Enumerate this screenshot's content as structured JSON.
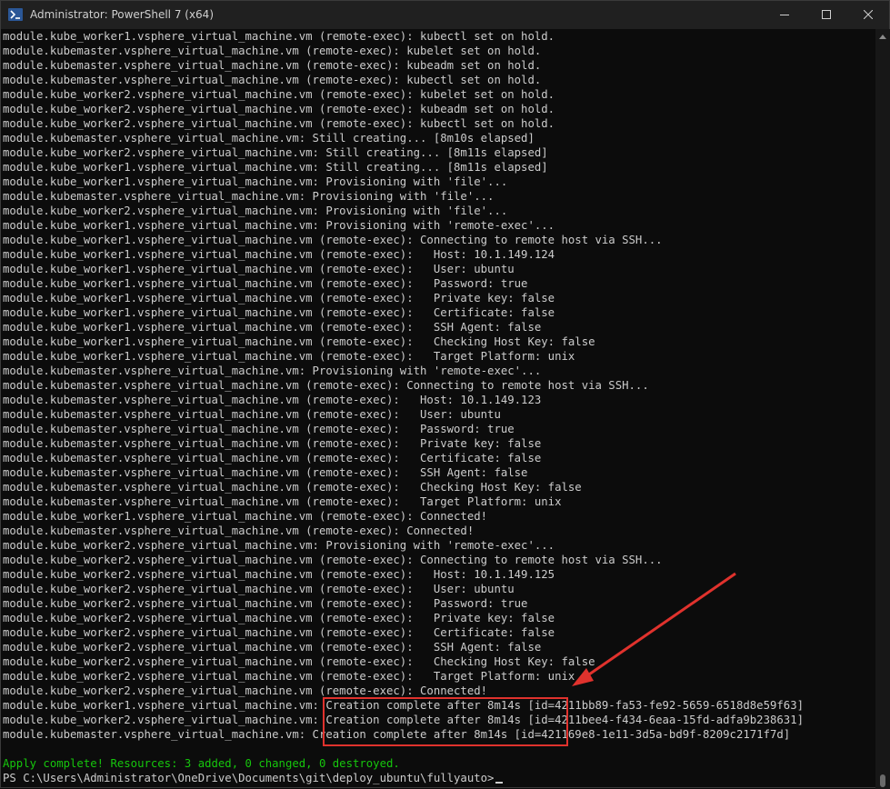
{
  "window": {
    "title": "Administrator: PowerShell 7 (x64)",
    "icon": "powershell-icon",
    "controls": {
      "minimize": "minimize-icon",
      "maximize": "maximize-icon",
      "close": "close-icon"
    }
  },
  "colors": {
    "output": "#cccccc",
    "success": "#16c60c",
    "annotation": "#e0322d"
  },
  "console": {
    "lines": [
      "module.kube_worker1.vsphere_virtual_machine.vm (remote-exec): kubectl set on hold.",
      "module.kubemaster.vsphere_virtual_machine.vm (remote-exec): kubelet set on hold.",
      "module.kubemaster.vsphere_virtual_machine.vm (remote-exec): kubeadm set on hold.",
      "module.kubemaster.vsphere_virtual_machine.vm (remote-exec): kubectl set on hold.",
      "module.kube_worker2.vsphere_virtual_machine.vm (remote-exec): kubelet set on hold.",
      "module.kube_worker2.vsphere_virtual_machine.vm (remote-exec): kubeadm set on hold.",
      "module.kube_worker2.vsphere_virtual_machine.vm (remote-exec): kubectl set on hold.",
      "module.kubemaster.vsphere_virtual_machine.vm: Still creating... [8m10s elapsed]",
      "module.kube_worker2.vsphere_virtual_machine.vm: Still creating... [8m11s elapsed]",
      "module.kube_worker1.vsphere_virtual_machine.vm: Still creating... [8m11s elapsed]",
      "module.kube_worker1.vsphere_virtual_machine.vm: Provisioning with 'file'...",
      "module.kubemaster.vsphere_virtual_machine.vm: Provisioning with 'file'...",
      "module.kube_worker2.vsphere_virtual_machine.vm: Provisioning with 'file'...",
      "module.kube_worker1.vsphere_virtual_machine.vm: Provisioning with 'remote-exec'...",
      "module.kube_worker1.vsphere_virtual_machine.vm (remote-exec): Connecting to remote host via SSH...",
      "module.kube_worker1.vsphere_virtual_machine.vm (remote-exec):   Host: 10.1.149.124",
      "module.kube_worker1.vsphere_virtual_machine.vm (remote-exec):   User: ubuntu",
      "module.kube_worker1.vsphere_virtual_machine.vm (remote-exec):   Password: true",
      "module.kube_worker1.vsphere_virtual_machine.vm (remote-exec):   Private key: false",
      "module.kube_worker1.vsphere_virtual_machine.vm (remote-exec):   Certificate: false",
      "module.kube_worker1.vsphere_virtual_machine.vm (remote-exec):   SSH Agent: false",
      "module.kube_worker1.vsphere_virtual_machine.vm (remote-exec):   Checking Host Key: false",
      "module.kube_worker1.vsphere_virtual_machine.vm (remote-exec):   Target Platform: unix",
      "module.kubemaster.vsphere_virtual_machine.vm: Provisioning with 'remote-exec'...",
      "module.kubemaster.vsphere_virtual_machine.vm (remote-exec): Connecting to remote host via SSH...",
      "module.kubemaster.vsphere_virtual_machine.vm (remote-exec):   Host: 10.1.149.123",
      "module.kubemaster.vsphere_virtual_machine.vm (remote-exec):   User: ubuntu",
      "module.kubemaster.vsphere_virtual_machine.vm (remote-exec):   Password: true",
      "module.kubemaster.vsphere_virtual_machine.vm (remote-exec):   Private key: false",
      "module.kubemaster.vsphere_virtual_machine.vm (remote-exec):   Certificate: false",
      "module.kubemaster.vsphere_virtual_machine.vm (remote-exec):   SSH Agent: false",
      "module.kubemaster.vsphere_virtual_machine.vm (remote-exec):   Checking Host Key: false",
      "module.kubemaster.vsphere_virtual_machine.vm (remote-exec):   Target Platform: unix",
      "module.kube_worker1.vsphere_virtual_machine.vm (remote-exec): Connected!",
      "module.kubemaster.vsphere_virtual_machine.vm (remote-exec): Connected!",
      "module.kube_worker2.vsphere_virtual_machine.vm: Provisioning with 'remote-exec'...",
      "module.kube_worker2.vsphere_virtual_machine.vm (remote-exec): Connecting to remote host via SSH...",
      "module.kube_worker2.vsphere_virtual_machine.vm (remote-exec):   Host: 10.1.149.125",
      "module.kube_worker2.vsphere_virtual_machine.vm (remote-exec):   User: ubuntu",
      "module.kube_worker2.vsphere_virtual_machine.vm (remote-exec):   Password: true",
      "module.kube_worker2.vsphere_virtual_machine.vm (remote-exec):   Private key: false",
      "module.kube_worker2.vsphere_virtual_machine.vm (remote-exec):   Certificate: false",
      "module.kube_worker2.vsphere_virtual_machine.vm (remote-exec):   SSH Agent: false",
      "module.kube_worker2.vsphere_virtual_machine.vm (remote-exec):   Checking Host Key: false",
      "module.kube_worker2.vsphere_virtual_machine.vm (remote-exec):   Target Platform: unix",
      "module.kube_worker2.vsphere_virtual_machine.vm (remote-exec): Connected!",
      "module.kube_worker1.vsphere_virtual_machine.vm: Creation complete after 8m14s [id=4211bb89-fa53-fe92-5659-6518d8e59f63]",
      "module.kube_worker2.vsphere_virtual_machine.vm: Creation complete after 8m14s [id=4211bee4-f434-6eaa-15fd-adfa9b238631]",
      "module.kubemaster.vsphere_virtual_machine.vm: Creation complete after 8m14s [id=421169e8-1e11-3d5a-bd9f-8209c2171f7d]",
      "",
      "Apply complete! Resources: 3 added, 0 changed, 0 destroyed.",
      "PS C:\\Users\\Administrator\\OneDrive\\Documents\\git\\deploy_ubuntu\\fullyauto>"
    ]
  }
}
